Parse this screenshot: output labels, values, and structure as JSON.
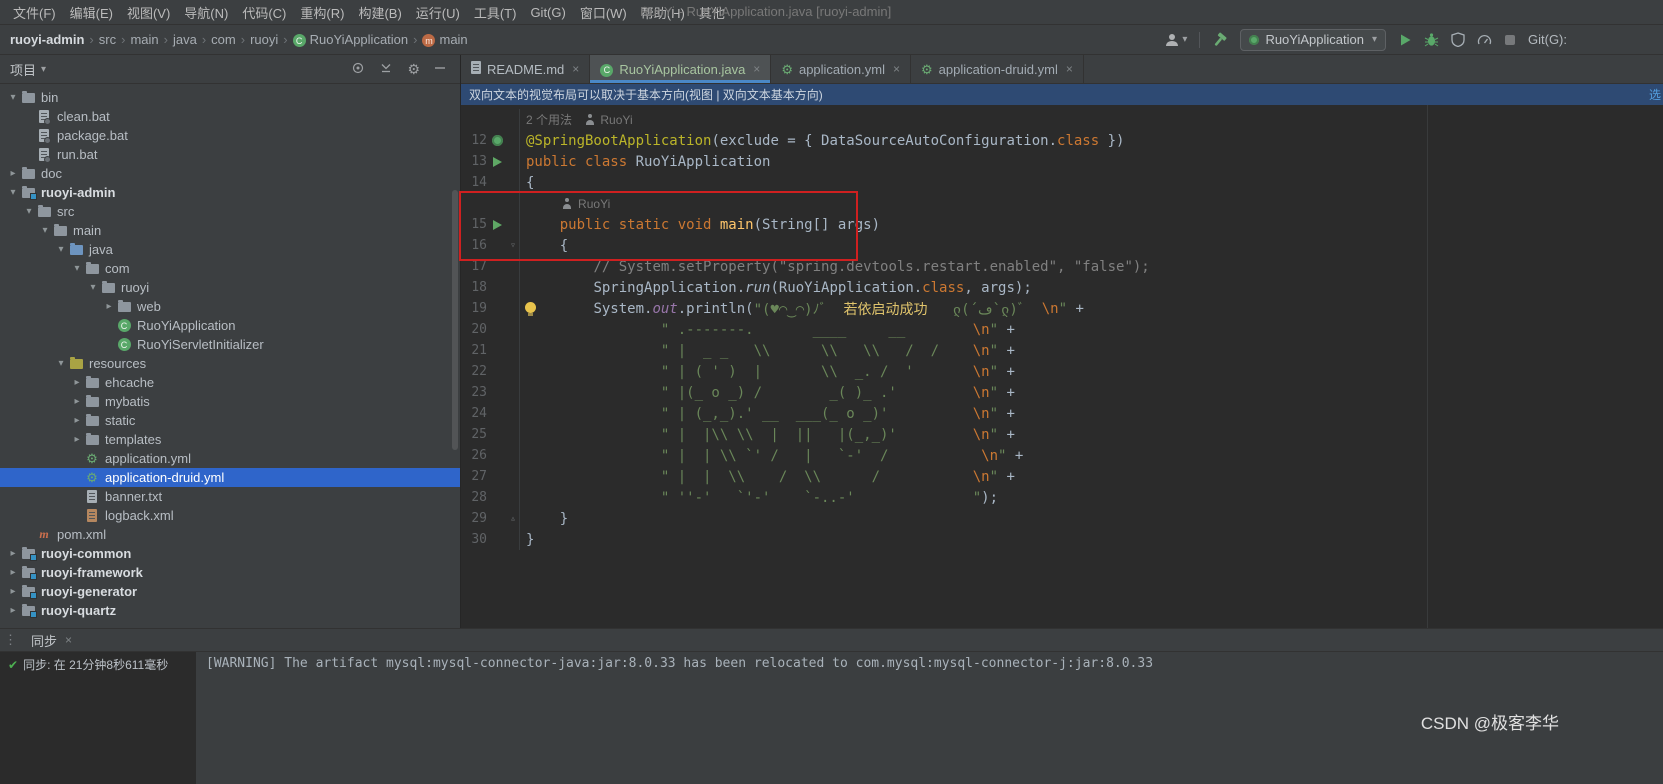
{
  "colors": {
    "selection": "#2f65ca",
    "run-green": "#59a869",
    "annotation-red": "#cf2020",
    "accent-blue": "#4a88c7",
    "banner-bg": "#2e4a73",
    "keyword": "#cc7832",
    "string": "#6a8759",
    "annotation": "#bbb529",
    "method": "#ffc66b",
    "comment": "#808080",
    "field": "#9876aa",
    "line-number": "#606366",
    "check-green": "#4db051"
  },
  "icons": {
    "close": "×",
    "grip": "⋮",
    "chevron_down": "▾",
    "chevron_open": "▾",
    "chevron_closed": "▸",
    "fold_down": "▿",
    "fold_up": "▵",
    "check": "✔",
    "gear": "⚙"
  },
  "window": {
    "title": "RuoYi - RuoYiApplication.java [ruoyi-admin]"
  },
  "menubar": {
    "items": [
      "文件(F)",
      "编辑(E)",
      "视图(V)",
      "导航(N)",
      "代码(C)",
      "重构(R)",
      "构建(B)",
      "运行(U)",
      "工具(T)",
      "Git(G)",
      "窗口(W)",
      "帮助(H)",
      "其他"
    ]
  },
  "toolbar": {
    "breadcrumbs": [
      {
        "label": "ruoyi-admin",
        "bold": true
      },
      {
        "label": "src"
      },
      {
        "label": "main"
      },
      {
        "label": "java"
      },
      {
        "label": "com"
      },
      {
        "label": "ruoyi"
      },
      {
        "label": "RuoYiApplication",
        "icon": "spring-class"
      },
      {
        "label": "main",
        "icon": "method"
      }
    ],
    "run_config": "RuoYiApplication",
    "git_label": "Git(G):"
  },
  "project_panel": {
    "title": "项目",
    "tree": [
      {
        "label": "bin",
        "icon": "folder",
        "level": 0,
        "chevron": "open"
      },
      {
        "label": "clean.bat",
        "icon": "bat",
        "level": 1
      },
      {
        "label": "package.bat",
        "icon": "bat",
        "level": 1
      },
      {
        "label": "run.bat",
        "icon": "bat",
        "level": 1
      },
      {
        "label": "doc",
        "icon": "folder",
        "level": 0,
        "chevron": "closed"
      },
      {
        "label": "ruoyi-admin",
        "icon": "module",
        "level": 0,
        "chevron": "open",
        "bold": true
      },
      {
        "label": "src",
        "icon": "folder",
        "level": 1,
        "chevron": "open"
      },
      {
        "label": "main",
        "icon": "folder",
        "level": 2,
        "chevron": "open"
      },
      {
        "label": "java",
        "icon": "folder-src",
        "level": 3,
        "chevron": "open"
      },
      {
        "label": "com",
        "icon": "folder",
        "level": 4,
        "chevron": "open"
      },
      {
        "label": "ruoyi",
        "icon": "folder",
        "level": 5,
        "chevron": "open"
      },
      {
        "label": "web",
        "icon": "folder",
        "level": 6,
        "chevron": "closed"
      },
      {
        "label": "RuoYiApplication",
        "icon": "spring-class",
        "level": 6
      },
      {
        "label": "RuoYiServletInitializer",
        "icon": "class",
        "level": 6
      },
      {
        "label": "resources",
        "icon": "folder-res",
        "level": 3,
        "chevron": "open"
      },
      {
        "label": "ehcache",
        "icon": "folder",
        "level": 4,
        "chevron": "closed"
      },
      {
        "label": "mybatis",
        "icon": "folder",
        "level": 4,
        "chevron": "closed"
      },
      {
        "label": "static",
        "icon": "folder",
        "level": 4,
        "chevron": "closed"
      },
      {
        "label": "templates",
        "icon": "folder",
        "level": 4,
        "chevron": "closed"
      },
      {
        "label": "application.yml",
        "icon": "spring-config",
        "level": 4
      },
      {
        "label": "application-druid.yml",
        "icon": "spring-config",
        "level": 4,
        "selected": true
      },
      {
        "label": "banner.txt",
        "icon": "txt",
        "level": 4
      },
      {
        "label": "logback.xml",
        "icon": "xml",
        "level": 4
      },
      {
        "label": "pom.xml",
        "icon": "maven",
        "level": 1
      },
      {
        "label": "ruoyi-common",
        "icon": "module",
        "level": 0,
        "chevron": "closed",
        "bold": true
      },
      {
        "label": "ruoyi-framework",
        "icon": "module",
        "level": 0,
        "chevron": "closed",
        "bold": true
      },
      {
        "label": "ruoyi-generator",
        "icon": "module",
        "level": 0,
        "chevron": "closed",
        "bold": true
      },
      {
        "label": "ruoyi-quartz",
        "icon": "module",
        "level": 0,
        "chevron": "closed",
        "bold": true
      }
    ]
  },
  "editor": {
    "tabs": [
      {
        "label": "README.md",
        "icon": "readme",
        "label_color": "#b5bcc2"
      },
      {
        "label": "RuoYiApplication.java",
        "icon": "spring-class",
        "active": true,
        "label_color": "#a8c5a0"
      },
      {
        "label": "application.yml",
        "icon": "spring-config",
        "label_color": "#a2abb3"
      },
      {
        "label": "application-druid.yml",
        "icon": "spring-config",
        "label_color": "#a2abb3"
      }
    ],
    "banner": {
      "text": "双向文本的视觉布局可以取决于基本方向(视图 | 双向文本基本方向)",
      "link": "选"
    },
    "code": {
      "lines": [
        {
          "hint": true,
          "segments": [
            {
              "t": "2 个用法",
              "c": "hint"
            },
            {
              "t": "   ",
              "c": "hint"
            },
            {
              "icon": "user"
            },
            {
              "t": " RuoYi",
              "c": "hint"
            }
          ]
        },
        {
          "num": 12,
          "gicon": "spring",
          "segments": [
            {
              "t": "@SpringBootApplication",
              "c": "ann"
            },
            {
              "t": "(exclude = { DataSourceAutoConfiguration.",
              "c": "def"
            },
            {
              "t": "class",
              "c": "kw"
            },
            {
              "t": " })",
              "c": "def"
            }
          ]
        },
        {
          "num": 13,
          "gicon": "run",
          "segments": [
            {
              "t": "public class ",
              "c": "kw"
            },
            {
              "t": "RuoYiApplication",
              "c": "def"
            }
          ]
        },
        {
          "num": 14,
          "segments": [
            {
              "t": "{",
              "c": "def"
            }
          ]
        },
        {
          "hint": true,
          "segments": [
            {
              "t": "    ",
              "c": "def"
            },
            {
              "icon": "user"
            },
            {
              "t": " RuoYi",
              "c": "hint"
            }
          ]
        },
        {
          "num": 15,
          "gicon": "run",
          "segments": [
            {
              "t": "    ",
              "c": "def"
            },
            {
              "t": "public static void ",
              "c": "kw"
            },
            {
              "t": "main",
              "c": "mth"
            },
            {
              "t": "(String[] args)",
              "c": "def"
            }
          ]
        },
        {
          "num": 16,
          "fold": "down",
          "segments": [
            {
              "t": "    {",
              "c": "def"
            }
          ]
        },
        {
          "num": 17,
          "segments": [
            {
              "t": "        ",
              "c": "def"
            },
            {
              "t": "// System.setProperty(\"spring.devtools.restart.enabled\", \"false\");",
              "c": "cmt"
            }
          ]
        },
        {
          "num": 18,
          "segments": [
            {
              "t": "        ",
              "c": "def"
            },
            {
              "t": "SpringApplication.",
              "c": "def"
            },
            {
              "t": "run",
              "c": "ital"
            },
            {
              "t": "(RuoYiApplication.",
              "c": "def"
            },
            {
              "t": "class",
              "c": "kw"
            },
            {
              "t": ", args);",
              "c": "def"
            }
          ]
        },
        {
          "num": 19,
          "bulb": true,
          "segments": [
            {
              "t": "        ",
              "c": "def"
            },
            {
              "t": "System.",
              "c": "def"
            },
            {
              "t": "out",
              "c": "fld"
            },
            {
              "t": ".println(",
              "c": "def"
            },
            {
              "t": "\"(♥◠‿◠)ﾉﾞ  ",
              "c": "str"
            },
            {
              "t": "若依启动成功",
              "c": "ch"
            },
            {
              "t": "   ლ(´ڡ`ლ)ﾞ  ",
              "c": "str"
            },
            {
              "t": "\\n",
              "c": "esc"
            },
            {
              "t": "\"",
              "c": "str"
            },
            {
              "t": " +",
              "c": "def"
            }
          ]
        },
        {
          "num": 20,
          "segments": [
            {
              "t": "                ",
              "c": "def"
            },
            {
              "t": "\" .-------.       ____     __        ",
              "c": "str"
            },
            {
              "t": "\\n",
              "c": "esc"
            },
            {
              "t": "\"",
              "c": "str"
            },
            {
              "t": " +",
              "c": "def"
            }
          ]
        },
        {
          "num": 21,
          "segments": [
            {
              "t": "                ",
              "c": "def"
            },
            {
              "t": "\" |  _ _   \\\\      \\\\   \\\\   /  /    ",
              "c": "str"
            },
            {
              "t": "\\n",
              "c": "esc"
            },
            {
              "t": "\"",
              "c": "str"
            },
            {
              "t": " +",
              "c": "def"
            }
          ]
        },
        {
          "num": 22,
          "segments": [
            {
              "t": "                ",
              "c": "def"
            },
            {
              "t": "\" | ( ' )  |       \\\\  _. /  '       ",
              "c": "str"
            },
            {
              "t": "\\n",
              "c": "esc"
            },
            {
              "t": "\"",
              "c": "str"
            },
            {
              "t": " +",
              "c": "def"
            }
          ]
        },
        {
          "num": 23,
          "segments": [
            {
              "t": "                ",
              "c": "def"
            },
            {
              "t": "\" |(_ o _) /        _( )_ .'         ",
              "c": "str"
            },
            {
              "t": "\\n",
              "c": "esc"
            },
            {
              "t": "\"",
              "c": "str"
            },
            {
              "t": " +",
              "c": "def"
            }
          ]
        },
        {
          "num": 24,
          "segments": [
            {
              "t": "                ",
              "c": "def"
            },
            {
              "t": "\" | (_,_).' __  ___(_ o _)'          ",
              "c": "str"
            },
            {
              "t": "\\n",
              "c": "esc"
            },
            {
              "t": "\"",
              "c": "str"
            },
            {
              "t": " +",
              "c": "def"
            }
          ]
        },
        {
          "num": 25,
          "segments": [
            {
              "t": "                ",
              "c": "def"
            },
            {
              "t": "\" |  |\\\\ \\\\  |  ||   |(_,_)'         ",
              "c": "str"
            },
            {
              "t": "\\n",
              "c": "esc"
            },
            {
              "t": "\"",
              "c": "str"
            },
            {
              "t": " +",
              "c": "def"
            }
          ]
        },
        {
          "num": 26,
          "segments": [
            {
              "t": "                ",
              "c": "def"
            },
            {
              "t": "\" |  | \\\\ `' /   |   `-'  /           ",
              "c": "str"
            },
            {
              "t": "\\n",
              "c": "esc"
            },
            {
              "t": "\"",
              "c": "str"
            },
            {
              "t": " +",
              "c": "def"
            }
          ]
        },
        {
          "num": 27,
          "segments": [
            {
              "t": "                ",
              "c": "def"
            },
            {
              "t": "\" |  |  \\\\    /  \\\\      /           ",
              "c": "str"
            },
            {
              "t": "\\n",
              "c": "esc"
            },
            {
              "t": "\"",
              "c": "str"
            },
            {
              "t": " +",
              "c": "def"
            }
          ]
        },
        {
          "num": 28,
          "segments": [
            {
              "t": "                ",
              "c": "def"
            },
            {
              "t": "\" ''-'   `'-'    `-..-'              \"",
              "c": "str"
            },
            {
              "t": ");",
              "c": "def"
            }
          ]
        },
        {
          "num": 29,
          "fold": "up",
          "segments": [
            {
              "t": "    }",
              "c": "def"
            }
          ]
        },
        {
          "num": 30,
          "segments": [
            {
              "t": "}",
              "c": "def"
            }
          ]
        }
      ]
    }
  },
  "bottom_panel": {
    "tab": "同步",
    "sync_status": "同步: 在 21分钟8秒611毫秒",
    "warning": "[WARNING] The artifact mysql:mysql-connector-java:jar:8.0.33 has been relocated to com.mysql:mysql-connector-j:jar:8.0.33"
  },
  "watermark": "CSDN @极客李华"
}
